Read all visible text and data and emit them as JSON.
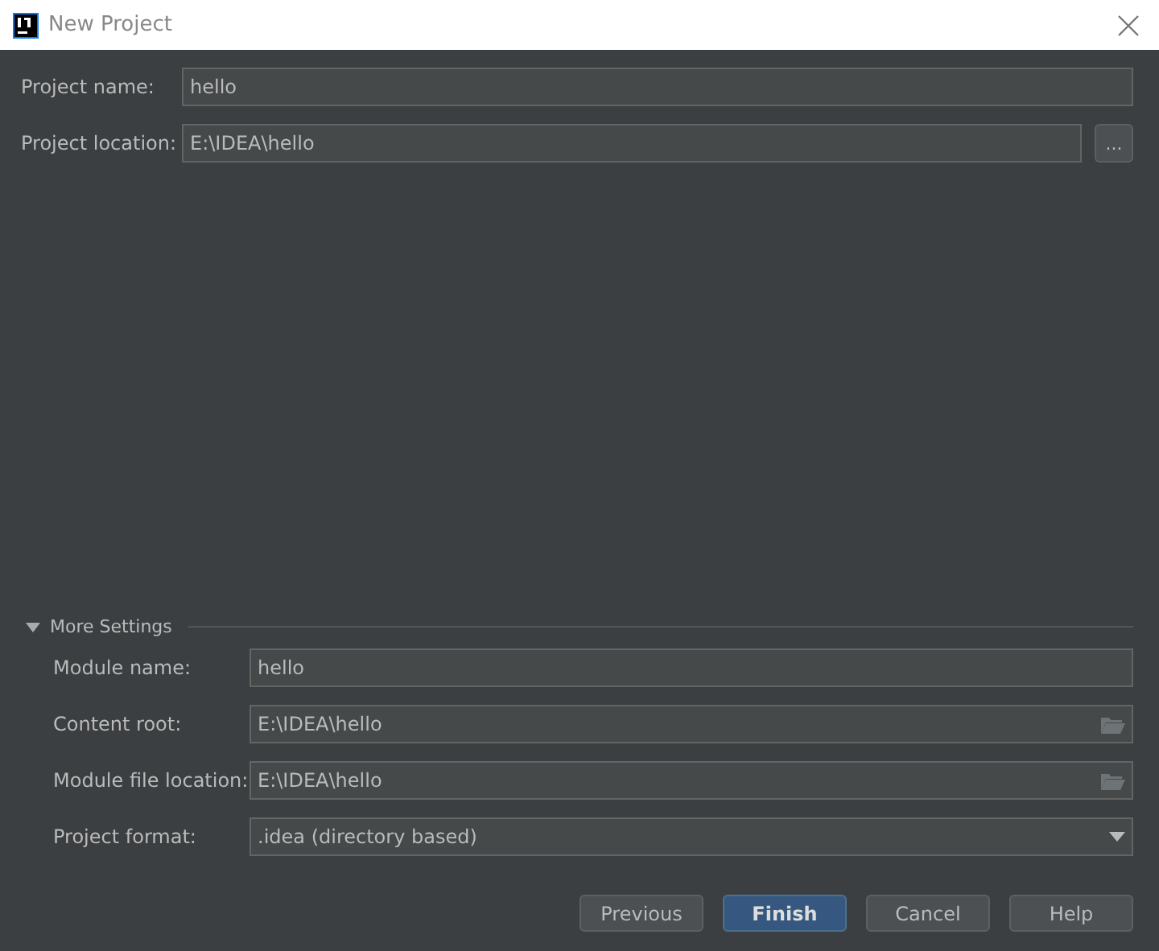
{
  "window": {
    "title": "New Project"
  },
  "project_fields": [
    {
      "label": "Project name:",
      "value": "hello",
      "kind": "text"
    },
    {
      "label": "Project location:",
      "value": "E:\\IDEA\\hello",
      "kind": "browse"
    }
  ],
  "more_settings": {
    "label": "More Settings",
    "expanded": true,
    "fields": [
      {
        "label": "Module name:",
        "value": "hello",
        "kind": "text"
      },
      {
        "label": "Content root:",
        "value": "E:\\IDEA\\hello",
        "kind": "folder"
      },
      {
        "label": "Module file location:",
        "value": "E:\\IDEA\\hello",
        "kind": "folder"
      },
      {
        "label": "Project format:",
        "value": ".idea (directory based)",
        "kind": "combo"
      }
    ]
  },
  "browse_button": {
    "label": "..."
  },
  "buttons": [
    {
      "label": "Previous",
      "default": false
    },
    {
      "label": "Finish",
      "default": true
    },
    {
      "label": "Cancel",
      "default": false
    },
    {
      "label": "Help",
      "default": false
    }
  ]
}
